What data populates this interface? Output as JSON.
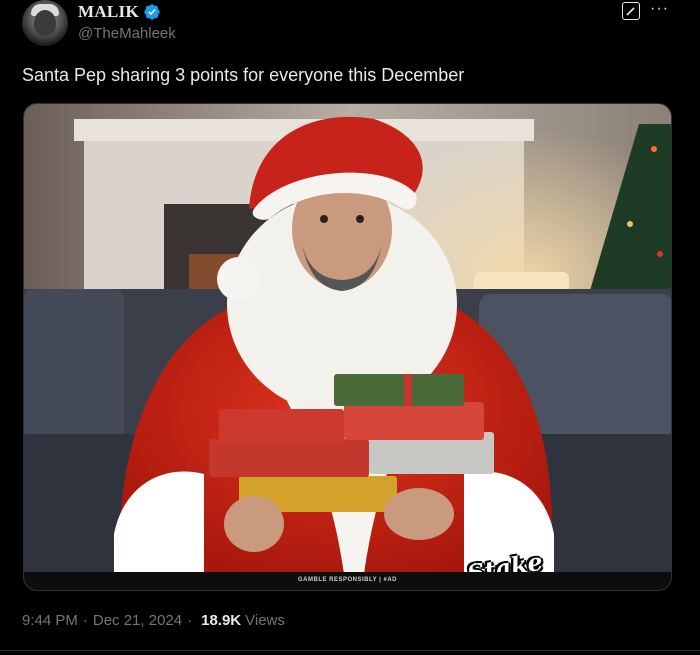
{
  "author": {
    "name": "MALIK",
    "handle": "@TheMahleek",
    "verified": true
  },
  "tweet": {
    "text": "Santa Pep sharing 3 points for everyone this December"
  },
  "media": {
    "ad_disclaimer": "GAMBLE RESPONSIBLY  |  #AD",
    "brand_logo": "Stake"
  },
  "meta": {
    "time": "9:44 PM",
    "date": "Dec 21, 2024",
    "views_count": "18.9K",
    "views_label": "Views"
  },
  "icons": {
    "verified": "verified-badge-icon",
    "edit": "edit-icon",
    "more": "more-icon"
  },
  "colors": {
    "background": "#000000",
    "verified": "#1d9bf0",
    "secondary_text": "#71767b"
  }
}
